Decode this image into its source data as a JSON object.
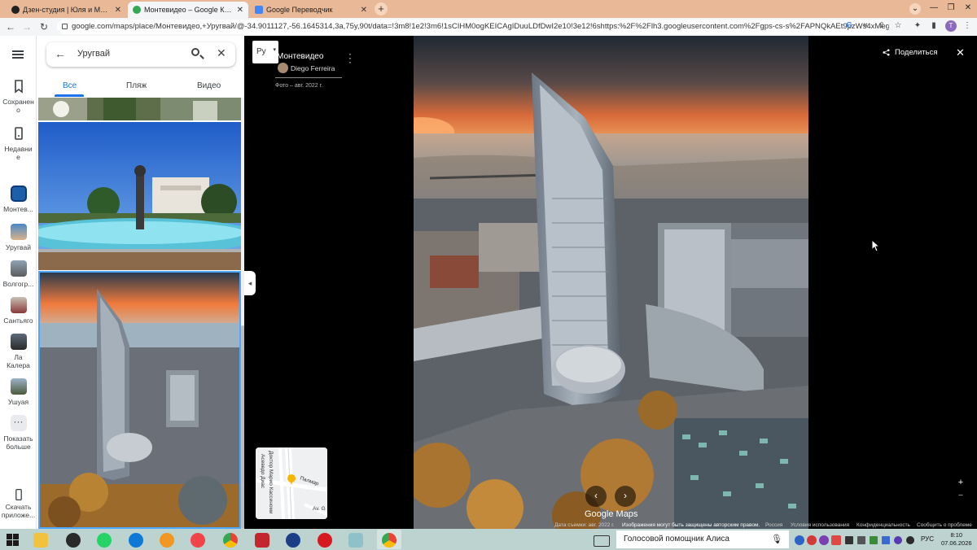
{
  "browser": {
    "tabs": [
      {
        "title": "Дзен-студия | Юля и Макс полу",
        "active": false,
        "favicon_color": "#222222"
      },
      {
        "title": "Монтевидео – Google Карты",
        "active": true,
        "favicon_color": "#34a853"
      },
      {
        "title": "Google Переводчик",
        "active": false,
        "favicon_color": "#4285f4"
      }
    ],
    "url": "google.com/maps/place/Монтевидео,+Уругвай/@-34.9011127,-56.1645314,3a,75y,90t/data=!3m8!1e2!3m6!1sCIHM0ogKEICAgIDuuLDfDwI2e10!3e12!6shttps:%2F%2Flh3.googleusercontent.com%2Fgps-cs-s%2FAPNQkAEt9pzWs4xMegRPT2...",
    "profile_initial": "T"
  },
  "rail": {
    "items": [
      {
        "label": "Сохранено",
        "icon": "bookmark-icon"
      },
      {
        "label": "Недавние",
        "icon": "history-icon"
      },
      {
        "label": "Монтев...",
        "icon": "place-thumb"
      },
      {
        "label": "Уругвай",
        "icon": "place-thumb"
      },
      {
        "label": "Волгогр...",
        "icon": "place-thumb"
      },
      {
        "label": "Сантьяго",
        "icon": "place-thumb"
      },
      {
        "label": "Ла Калера",
        "icon": "place-thumb"
      },
      {
        "label": "Ушуая",
        "icon": "place-thumb"
      },
      {
        "label": "Показать больше",
        "icon": "more-icon"
      },
      {
        "label": "Скачать приложе...",
        "icon": "phone-icon"
      }
    ]
  },
  "search": {
    "query": "Уругвай"
  },
  "filters": {
    "all": "Все",
    "beach": "Пляж",
    "video": "Видео"
  },
  "viewer": {
    "lang": "Ру",
    "title": "Монтевидео",
    "author": "Diego Ferreira",
    "date": "Фото – авг. 2022 г.",
    "share": "Поделиться",
    "logo": "Google Maps",
    "footer": {
      "capture": "Дата съемки: авг. 2022 г.",
      "rights": "Изображения могут быть защищены авторским правом.",
      "country": "Россия",
      "terms": "Условия использования",
      "privacy": "Конфиденциальность",
      "report": "Сообщить о проблеме"
    },
    "minimap": {
      "street1": "Доктор Марио Кассиноми",
      "street2": "Асеведо Диас",
      "street3": "Палмар",
      "street4": "Av. G"
    }
  },
  "taskbar": {
    "assistant": "Голосовой помощник Алиса",
    "lang": "РУС",
    "time": "8:10",
    "date": "07.06.2026"
  }
}
